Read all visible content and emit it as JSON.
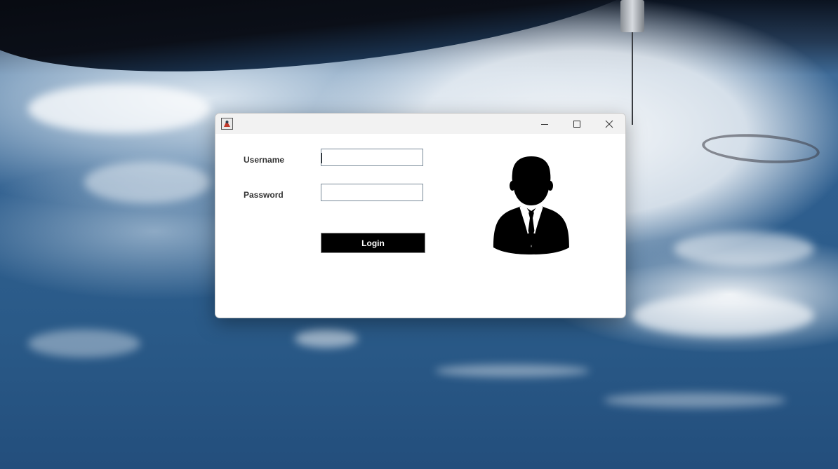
{
  "window": {
    "icon": "java-app-icon",
    "buttons": {
      "minimize": "minimize-icon",
      "maximize": "maximize-icon",
      "close": "close-icon"
    }
  },
  "form": {
    "username_label": "Username",
    "username_value": "",
    "password_label": "Password",
    "password_value": "",
    "login_label": "Login"
  },
  "avatar": {
    "icon": "user-avatar-icon",
    "color": "#000000"
  },
  "colors": {
    "button_bg": "#000000",
    "button_text": "#ffffff",
    "titlebar_bg": "#f2f2f2"
  }
}
